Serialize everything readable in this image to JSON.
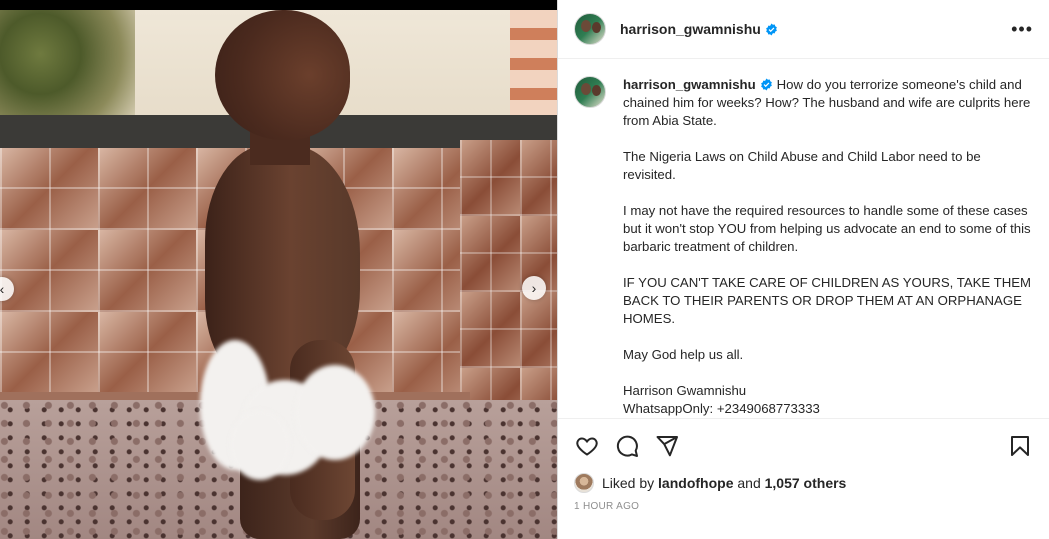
{
  "post": {
    "username": "harrison_gwamnishu",
    "verified": true,
    "more_icon": "more-horizontal-icon",
    "media_alt": "Photo of a malnourished child standing against a tiled wall"
  },
  "caption": {
    "username": "harrison_gwamnishu",
    "paragraphs": [
      "How do you terrorize someone's child and chained him for weeks? How? The husband and wife are culprits here from Abia State.",
      "The Nigeria Laws on Child Abuse and Child Labor need to be revisited.",
      "I may not have the required resources to handle some of these cases but it won't stop YOU from helping us advocate an end to some of this barbaric treatment of children.",
      "IF YOU CAN'T TAKE CARE OF CHILDREN AS YOURS, TAKE THEM BACK TO THEIR PARENTS OR DROP THEM AT AN ORPHANAGE HOMES.",
      "May God help us all."
    ],
    "signature_name": "Harrison Gwamnishu",
    "signature_contact": "WhatsappOnly: +2349068773333"
  },
  "actions": {
    "like_icon": "heart-icon",
    "comment_icon": "comment-icon",
    "share_icon": "share-icon",
    "save_icon": "bookmark-icon"
  },
  "likes": {
    "prefix": "Liked by",
    "first_user": "landofhope",
    "conjunction": "and",
    "others": "1,057 others"
  },
  "timestamp": "1 HOUR AGO",
  "colors": {
    "verified": "#0095f6",
    "text": "#262626",
    "muted": "#8e8e8e"
  }
}
